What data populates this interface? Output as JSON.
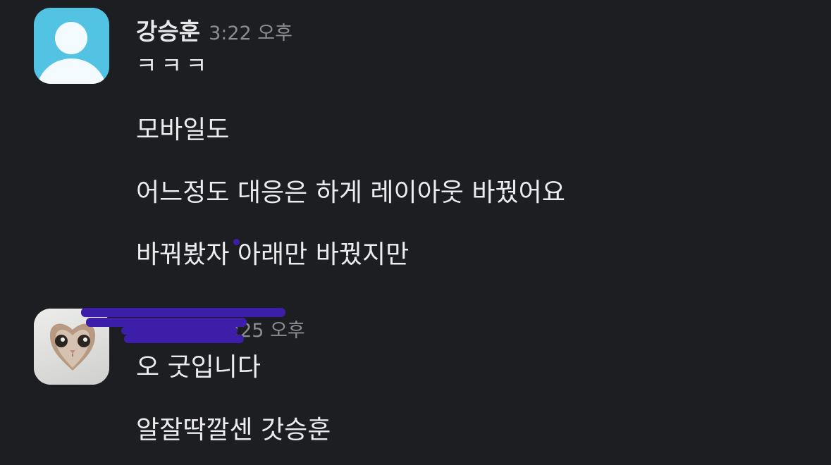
{
  "messages": [
    {
      "sender": "강승훈",
      "time": "3:22 오후",
      "avatar_icon": "default-user-avatar-icon",
      "lines": [
        "ㅋㅋㅋ",
        "모바일도",
        "어느정도 대응은 하게 레이아웃 바꿨어요",
        "바꿔봤자 아래만 바꿨지만"
      ]
    },
    {
      "sender": "",
      "time": ":25 오후",
      "avatar_icon": "cat-photo-avatar-icon",
      "lines": [
        "오 굿입니다",
        "알잘딱깔센 갓승훈"
      ]
    }
  ],
  "colors": {
    "background": "#1d1e21",
    "text": "#ececee",
    "timestamp": "#8c8d92",
    "default_avatar": "#53c3e3",
    "redaction": "#3d1ea8"
  }
}
